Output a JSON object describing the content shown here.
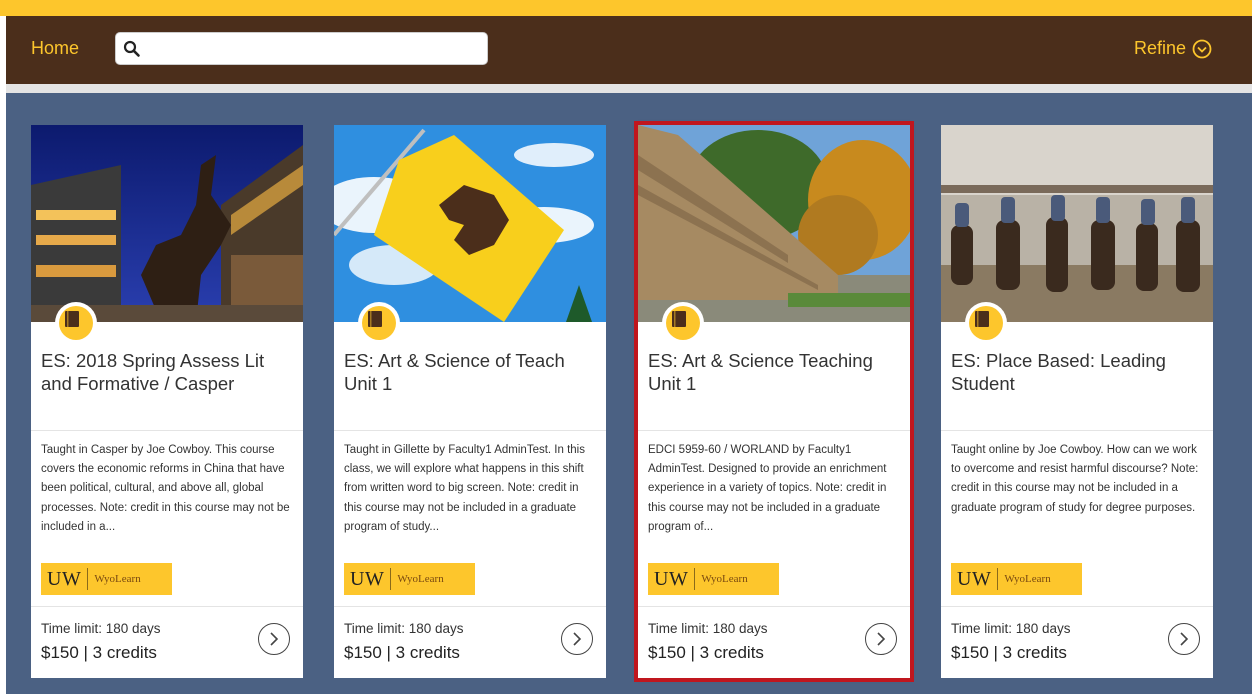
{
  "header": {
    "home_label": "Home",
    "search_value": "",
    "search_placeholder": "",
    "refine_label": "Refine"
  },
  "colors": {
    "brand_gold": "#fdc62c",
    "brand_brown": "#4b2e1b",
    "background_blue": "#4b6183",
    "selected_outline": "#c0161e"
  },
  "cards": [
    {
      "title": "ES: 2018 Spring Assess Lit and Formative / Casper",
      "description": "Taught in Casper by Joe Cowboy. This course covers the economic reforms in China that have been political, cultural, and above all, global processes. Note: credit in this course may not be included in a...",
      "logo_mark": "UW",
      "logo_text": "WyoLearn",
      "time_limit": "Time limit: 180 days",
      "price": "$150 | 3 credits",
      "image": "bronze-cowboy-statue-night"
    },
    {
      "title": "ES: Art & Science of Teach Unit 1",
      "description": "Taught in Gillette by Faculty1 AdminTest. In this class, we will explore what happens in this shift from written word to big screen. Note: credit in this course may not be included in a graduate program of study...",
      "logo_mark": "UW",
      "logo_text": "WyoLearn",
      "time_limit": "Time limit: 180 days",
      "price": "$150 | 3 credits",
      "image": "yellow-bucking-horse-flag"
    },
    {
      "title": "ES: Art & Science Teaching Unit 1",
      "description": "EDCI 5959-60 / WORLAND by Faculty1 AdminTest. Designed to provide an enrichment experience in a variety of topics. Note: credit in this course may not be included in a graduate program of...",
      "logo_mark": "UW",
      "logo_text": "WyoLearn",
      "time_limit": "Time limit: 180 days",
      "price": "$150 | 3 credits",
      "image": "university-stone-wall-sign",
      "selected": true
    },
    {
      "title": "ES: Place Based: Leading Student",
      "description": "Taught online by Joe Cowboy. How can we work to overcome and resist harmful discourse? Note: credit in this course may not be included in a graduate program of study for degree purposes.",
      "logo_mark": "UW",
      "logo_text": "WyoLearn",
      "time_limit": "Time limit: 180 days",
      "price": "$150 | 3 credits",
      "image": "riders-on-horses-arena"
    }
  ]
}
